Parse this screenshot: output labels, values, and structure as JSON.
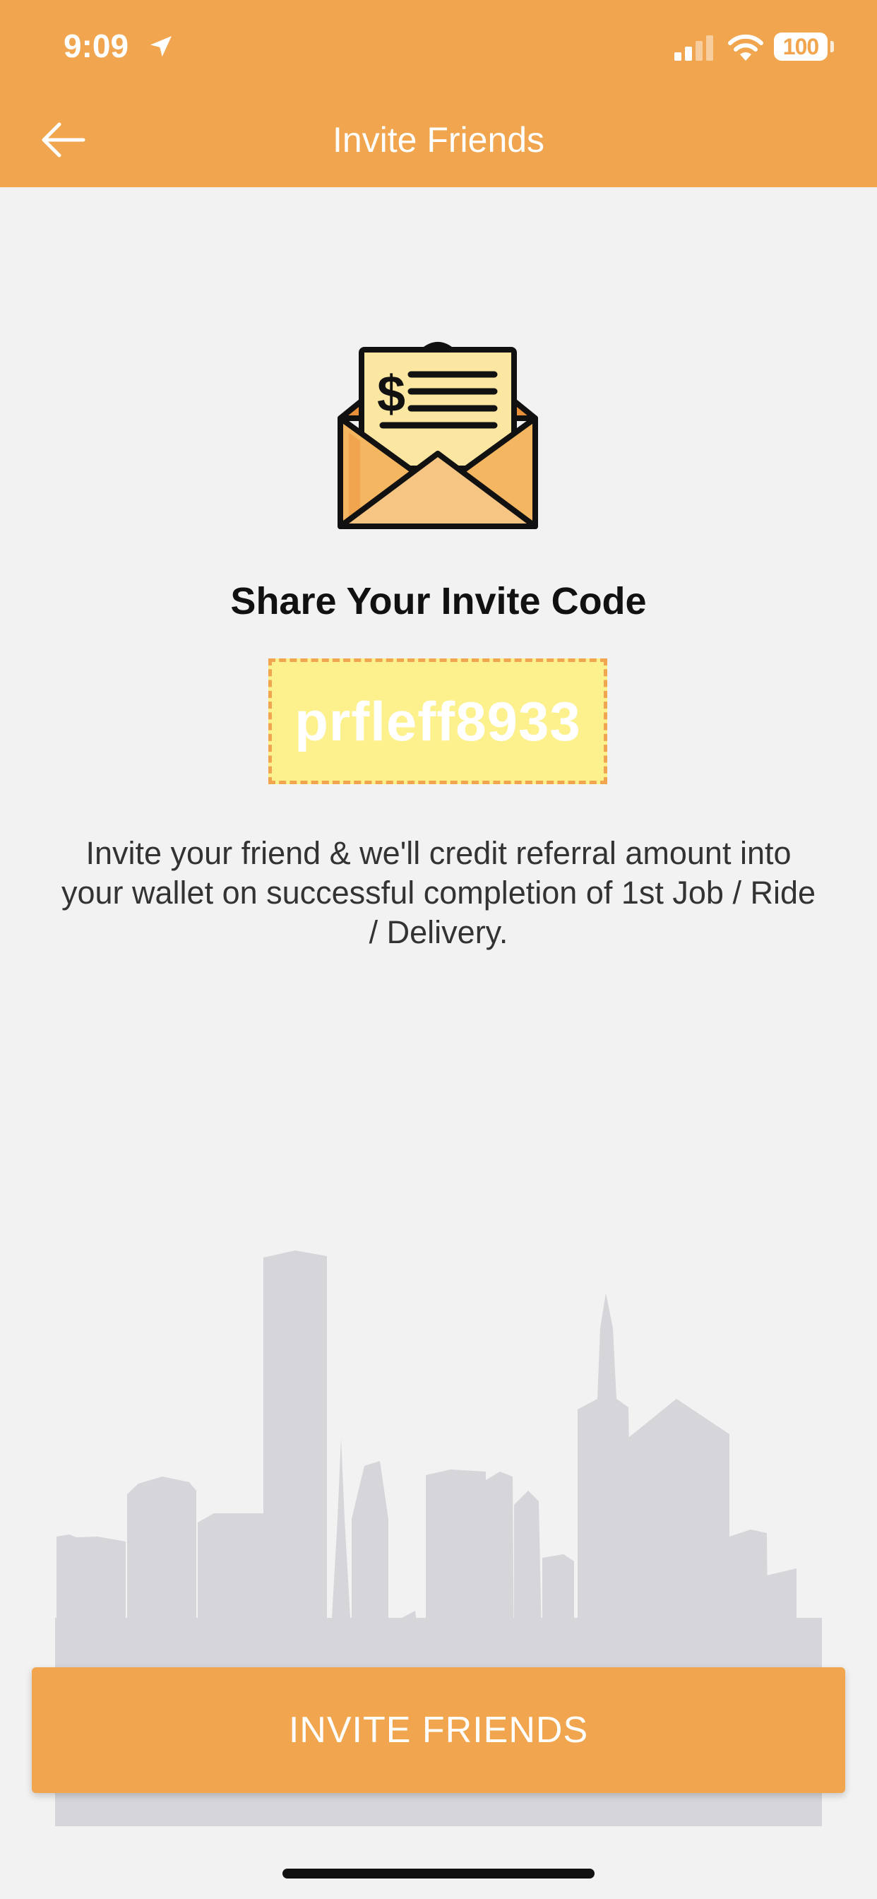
{
  "status_bar": {
    "time": "9:09",
    "battery": "100",
    "icons": [
      "location-arrow-icon",
      "cellular-signal-icon",
      "wifi-icon",
      "battery-icon"
    ]
  },
  "header": {
    "title": "Invite Friends",
    "back_icon": "arrow-left-icon"
  },
  "main": {
    "illustration": "envelope-money-icon",
    "share_title": "Share Your Invite Code",
    "invite_code": "prfleff8933",
    "description": "Invite your friend & we'll credit referral amount into your wallet on successful completion of 1st Job / Ride / Delivery."
  },
  "footer": {
    "invite_button_label": "INVITE FRIENDS"
  },
  "colors": {
    "accent": "#f0a54e",
    "background": "#f2f2f2",
    "code_box": "#fdf18e",
    "skyline": "#d6d6da"
  }
}
